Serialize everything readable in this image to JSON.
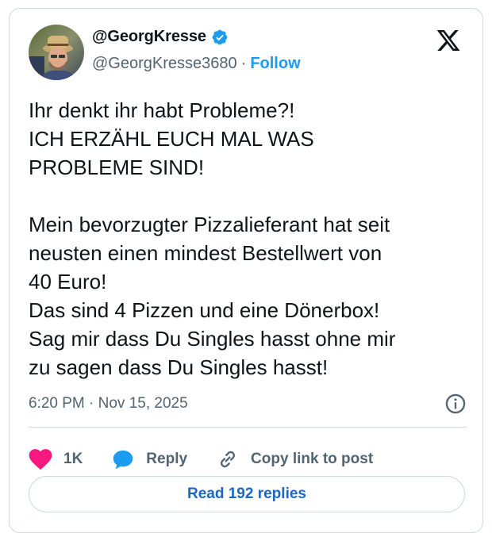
{
  "author": {
    "display_name": "@GeorgKresse",
    "handle": "@GeorgKresse3680",
    "separator": "·",
    "follow_label": "Follow",
    "verified": true
  },
  "tweet": {
    "text": "Ihr denkt ihr habt Probleme?!\nICH ERZÄHL EUCH MAL WAS\nPROBLEME SIND!\n\nMein bevorzugter Pizzalieferant hat seit\nneusten einen mindest Bestellwert von\n40 Euro!\nDas sind 4 Pizzen und eine Dönerbox!\nSag mir dass Du Singles hasst ohne mir\nzu sagen dass Du Singles hasst!",
    "timestamp": "6:20 PM · Nov 15, 2025"
  },
  "actions": {
    "likes": "1K",
    "reply_label": "Reply",
    "copy_label": "Copy link to post"
  },
  "read_replies_label": "Read 192 replies",
  "colors": {
    "accent": "#1d9bf0",
    "like": "#f91880",
    "muted": "#536471",
    "border": "#cfd9de"
  },
  "icons": [
    "avatar",
    "verified-badge-icon",
    "x-logo-icon",
    "info-icon",
    "heart-icon",
    "reply-bubble-icon",
    "link-icon"
  ]
}
